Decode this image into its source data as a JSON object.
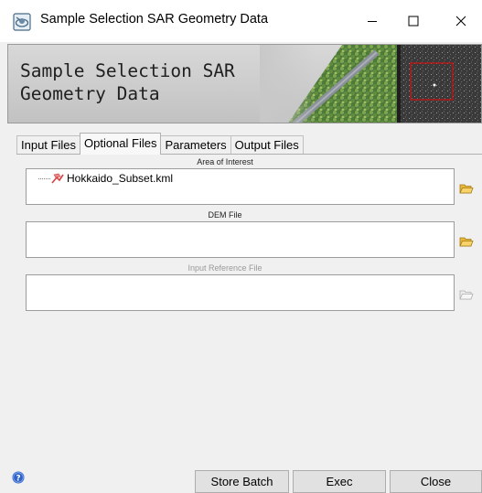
{
  "window": {
    "title": "Sample Selection SAR Geometry Data",
    "icons": {
      "app": "satellite-app-icon",
      "minimize": "minimize-icon",
      "maximize": "maximize-icon",
      "close": "close-icon"
    }
  },
  "banner": {
    "title": "Sample Selection SAR\nGeometry Data"
  },
  "tabs": [
    {
      "label": "Input Files",
      "active": false
    },
    {
      "label": "Optional Files",
      "active": true
    },
    {
      "label": "Parameters",
      "active": false
    },
    {
      "label": "Output Files",
      "active": false
    }
  ],
  "fields": {
    "area_of_interest": {
      "label": "Area of Interest",
      "items": [
        "Hokkaido_Subset.kml"
      ],
      "enabled": true
    },
    "dem_file": {
      "label": "DEM File",
      "items": [],
      "enabled": true
    },
    "input_reference_file": {
      "label": "Input Reference File",
      "items": [],
      "enabled": false
    }
  },
  "footer": {
    "store_batch": "Store Batch",
    "exec": "Exec",
    "close": "Close"
  },
  "colors": {
    "folder": "#e9b73a",
    "folder_disabled": "#d8d8d8",
    "help": "#2f62c8",
    "banner_box": "#d01010"
  }
}
